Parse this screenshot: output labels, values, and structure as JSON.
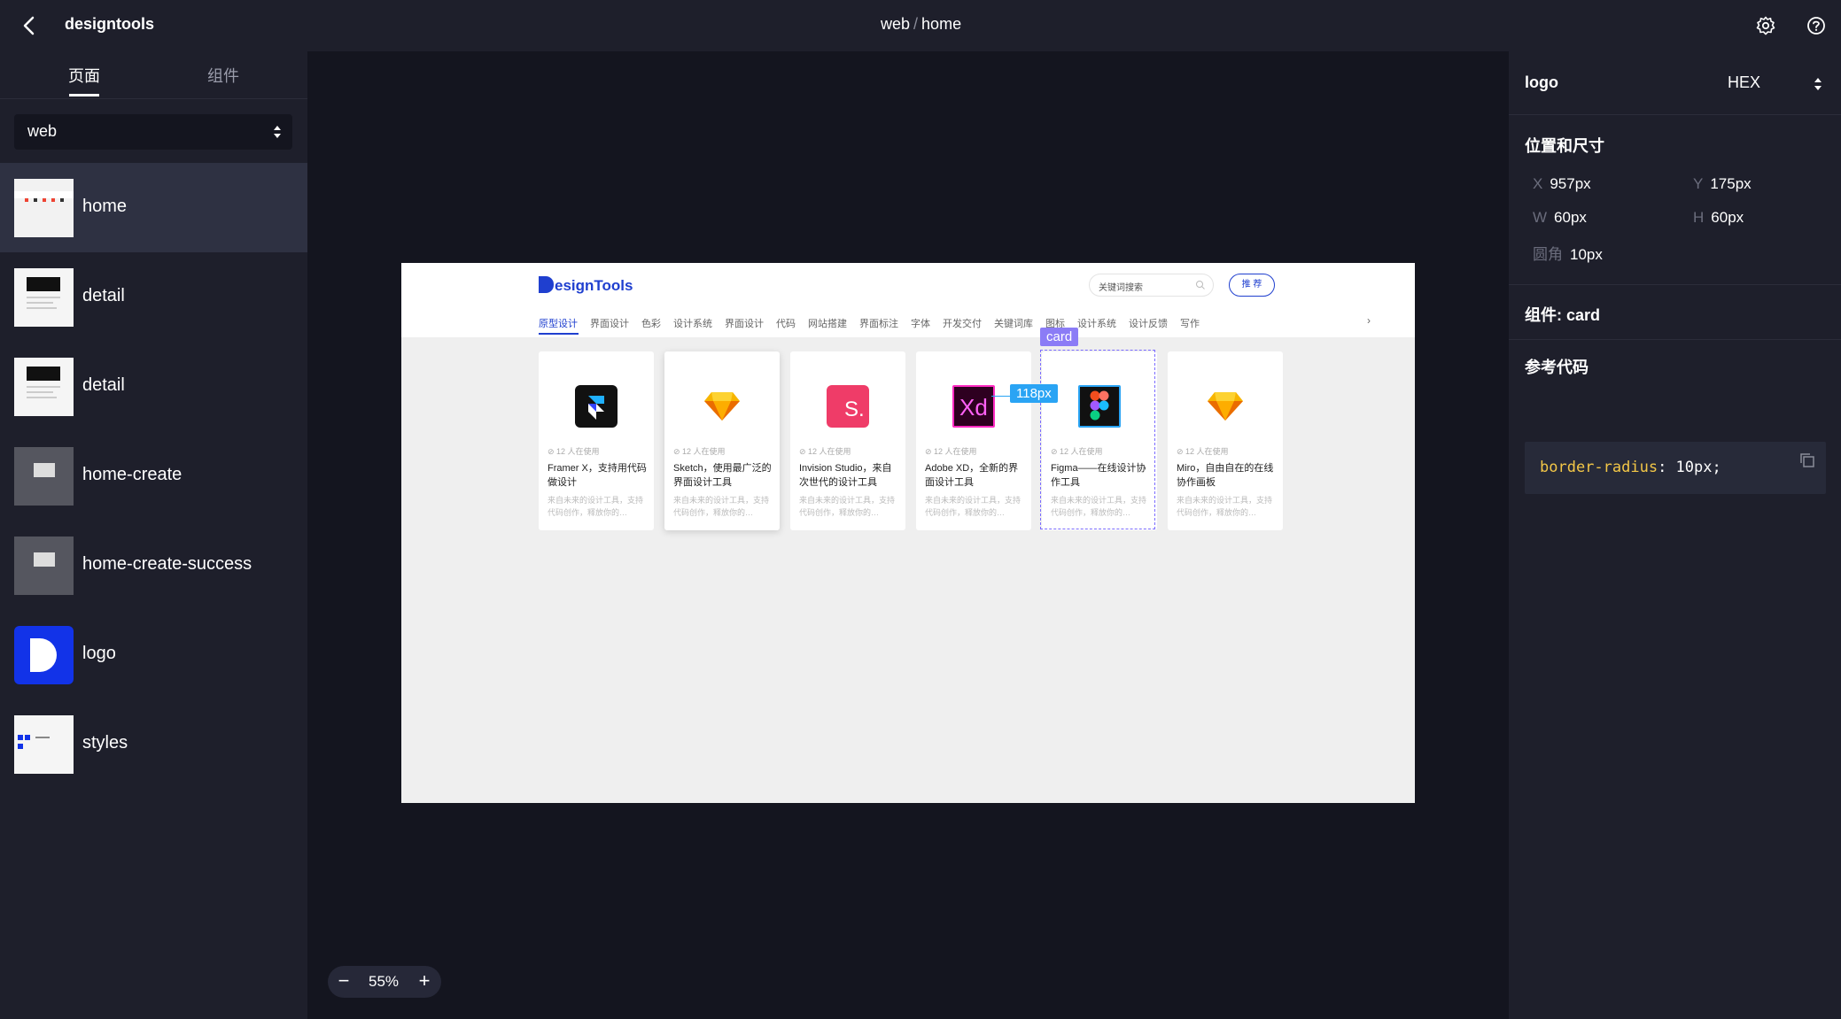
{
  "topbar": {
    "app_name": "designtools",
    "breadcrumb": {
      "project": "web",
      "separator": "/",
      "page": "home"
    },
    "icons": [
      "back-arrow-icon",
      "gear-icon",
      "help-icon"
    ]
  },
  "sidebar": {
    "tabs": [
      {
        "label": "页面",
        "active": true
      },
      {
        "label": "组件",
        "active": false
      }
    ],
    "select_value": "web",
    "pages": [
      {
        "label": "home",
        "active": true
      },
      {
        "label": "detail"
      },
      {
        "label": "detail"
      },
      {
        "label": "home-create"
      },
      {
        "label": "home-create-success"
      },
      {
        "label": "logo"
      },
      {
        "label": "styles"
      }
    ]
  },
  "artboard": {
    "brand": "DesignTools",
    "brand_rest": "esignTools",
    "search_placeholder": "关键词搜索",
    "button": "推 荐",
    "nav": [
      "原型设计",
      "界面设计",
      "色彩",
      "设计系统",
      "界面设计",
      "代码",
      "网站搭建",
      "界面标注",
      "字体",
      "开发交付",
      "关键词库",
      "图标",
      "设计系统",
      "设计反馈",
      "写作"
    ],
    "nav_more": "›",
    "cards": [
      {
        "meta": "⊘ 12 人在使用",
        "title": "Framer X，支持用代码做设计",
        "desc": "来自未来的设计工具，支持代码创作，释放你的…",
        "icon": "framer-icon",
        "color": "#111111"
      },
      {
        "meta": "⊘ 12 人在使用",
        "title": "Sketch，使用最广泛的界面设计工具",
        "desc": "来自未来的设计工具，支持代码创作，释放你的…",
        "icon": "sketch-icon",
        "color": "#f7b500"
      },
      {
        "meta": "⊘ 12 人在使用",
        "title": "Invision Studio，来自次世代的设计工具",
        "desc": "来自未来的设计工具，支持代码创作，释放你的…",
        "icon": "invision-icon",
        "color": "#ef3c68"
      },
      {
        "meta": "⊘ 12 人在使用",
        "title": "Adobe XD，全新的界面设计工具",
        "desc": "来自未来的设计工具，支持代码创作，释放你的…",
        "icon": "xd-icon",
        "color": "#2e0020"
      },
      {
        "meta": "⊘ 12 人在使用",
        "title": "Figma——在线设计协作工具",
        "desc": "来自未来的设计工具，支持代码创作，释放你的…",
        "icon": "figma-icon",
        "color": "#111111"
      },
      {
        "meta": "⊘ 12 人在使用",
        "title": "Miro，自由自在的在线协作画板",
        "desc": "来自未来的设计工具，支持代码创作，释放你的…",
        "icon": "sketch-icon",
        "color": "#f7b500"
      }
    ],
    "component_tag": "card",
    "distance_tag": "118px",
    "xd_label": "Xd",
    "invision_label": "S."
  },
  "zoom": {
    "minus": "−",
    "value": "55%",
    "plus": "+"
  },
  "panel": {
    "layer_name": "logo",
    "color_format": "HEX",
    "position_title": "位置和尺寸",
    "props": {
      "x_key": "X",
      "x_val": "957px",
      "y_key": "Y",
      "y_val": "175px",
      "w_key": "W",
      "w_val": "60px",
      "h_key": "H",
      "h_val": "60px",
      "r_key": "圆角",
      "r_val": "10px"
    },
    "component_label": "组件: card",
    "code_title": "参考代码",
    "code_prop": "border-radius",
    "code_rest": ": 10px;"
  },
  "colors": {
    "accent": "#1f3fcf",
    "tag_purple": "#8b7cf6",
    "tag_blue": "#2aa4f4",
    "code_yellow": "#f3c747"
  }
}
